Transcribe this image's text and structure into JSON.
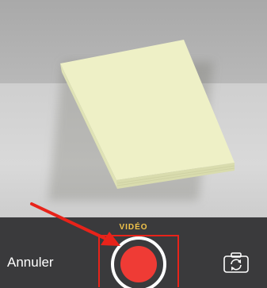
{
  "camera": {
    "mode_label": "VIDÉO",
    "cancel_label": "Annuler",
    "record_button_icon": "record-icon",
    "switch_camera_icon": "camera-flip-icon"
  },
  "annotation": {
    "arrow_icon": "red-arrow-icon",
    "highlight_color": "#e8231a"
  },
  "colors": {
    "mode_label": "#f2c44a",
    "record": "#ef3b35",
    "control_bar": "#3a3a3c"
  }
}
